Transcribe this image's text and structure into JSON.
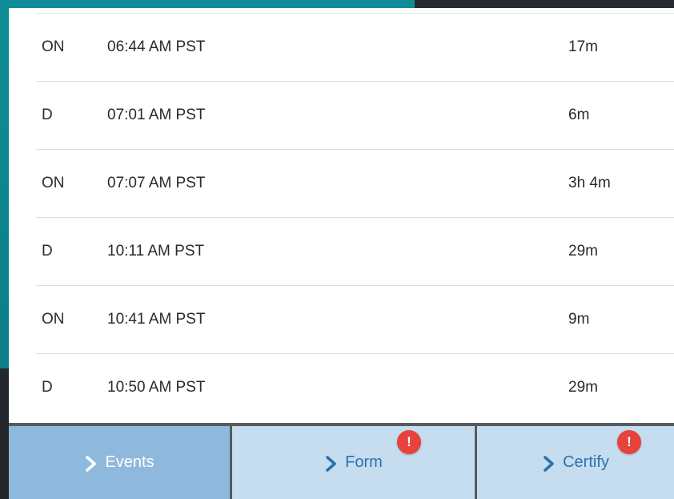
{
  "log_rows": [
    {
      "status": "ON",
      "time": "06:44 AM PST",
      "duration": "17m"
    },
    {
      "status": "D",
      "time": "07:01 AM PST",
      "duration": "6m"
    },
    {
      "status": "ON",
      "time": "07:07 AM PST",
      "duration": "3h 4m"
    },
    {
      "status": "D",
      "time": "10:11 AM PST",
      "duration": "29m"
    },
    {
      "status": "ON",
      "time": "10:41 AM PST",
      "duration": "9m"
    },
    {
      "status": "D",
      "time": "10:50 AM PST",
      "duration": "29m"
    }
  ],
  "tabs": {
    "events": {
      "label": "Events"
    },
    "form": {
      "label": "Form",
      "badge": "!"
    },
    "certify": {
      "label": "Certify",
      "badge": "!"
    }
  },
  "icons": {
    "tab_chevron": "chevron-right-icon",
    "alert_badge": "exclamation-icon"
  },
  "colors": {
    "teal_background": "#0f8c97",
    "tab_active": "#8fb9dc",
    "tab_inactive": "#c6dcef",
    "tab_text": "#2a72b0",
    "badge_red": "#e8423c"
  }
}
